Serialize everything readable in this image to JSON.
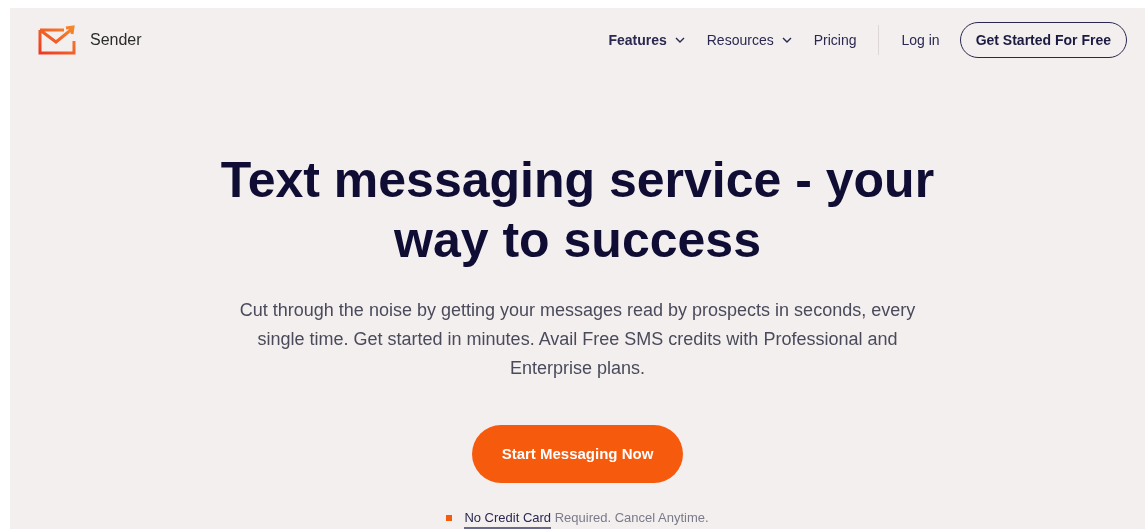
{
  "brand": {
    "name": "Sender"
  },
  "nav": {
    "items": [
      {
        "label": "Features",
        "dropdown": true,
        "selected": true
      },
      {
        "label": "Resources",
        "dropdown": true,
        "selected": false
      },
      {
        "label": "Pricing",
        "dropdown": false,
        "selected": false
      }
    ],
    "login": "Log in",
    "cta": "Get Started For Free"
  },
  "hero": {
    "title": "Text messaging service - your way to success",
    "subtitle": "Cut through the noise by getting your messages read by prospects in seconds, every single time. Get started in minutes. Avail Free SMS credits with Professional and Enterprise plans.",
    "button": "Start Messaging Now",
    "note": {
      "link": "No Credit Card",
      "rest": "Required. Cancel Anytime."
    }
  }
}
